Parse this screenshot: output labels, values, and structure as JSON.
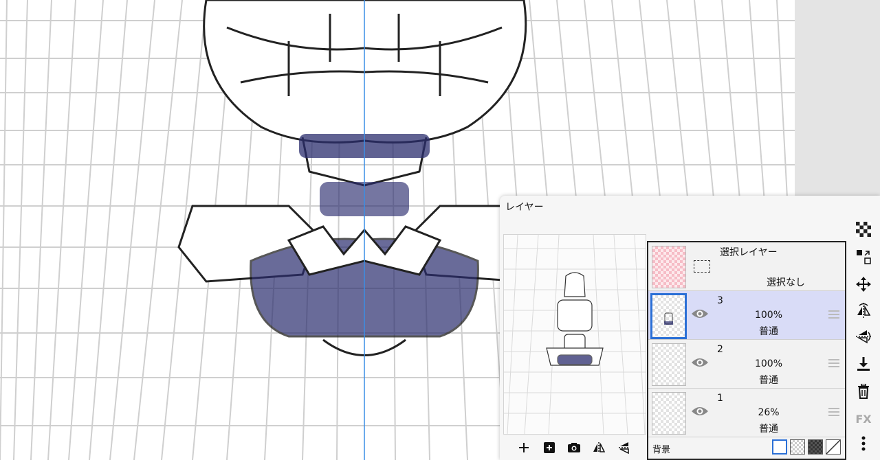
{
  "panel": {
    "title": "レイヤー"
  },
  "layers": [
    {
      "name": "選択レイヤー",
      "status": "選択なし"
    },
    {
      "name": "3",
      "opacity": "100%",
      "blend": "普通"
    },
    {
      "name": "2",
      "opacity": "100%",
      "blend": "普通"
    },
    {
      "name": "1",
      "opacity": "26%",
      "blend": "普通"
    }
  ],
  "background": {
    "label": "背景"
  },
  "side_tools": {
    "fx_label": "FX"
  },
  "colors": {
    "accent": "#2a6fd6",
    "selected_row": "#d9dcf7",
    "ink_shade": "#2b2d6e",
    "symmetry_guide": "#3a8ee6"
  }
}
